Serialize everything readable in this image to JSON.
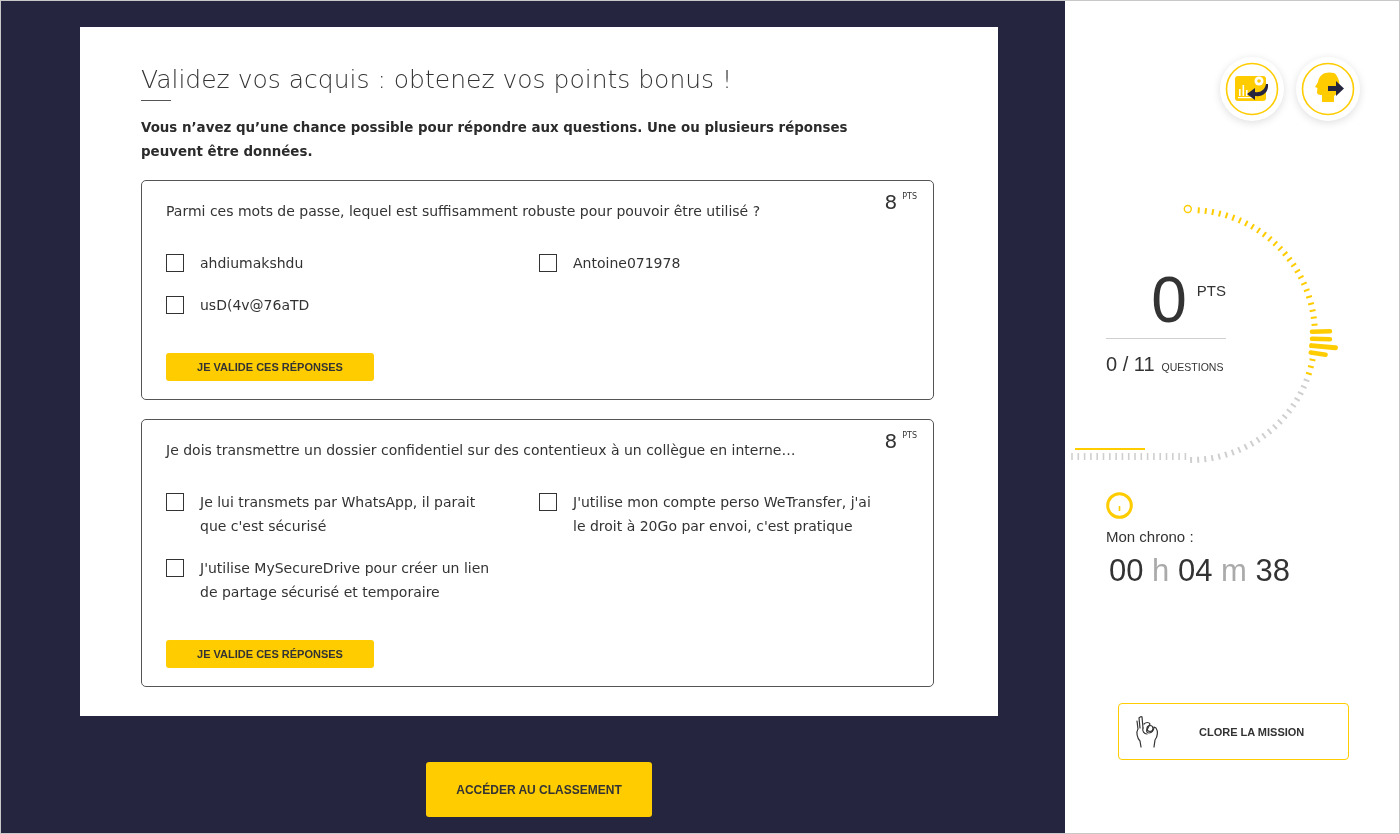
{
  "quiz": {
    "title": "Validez vos acquis : obtenez vos points bonus !",
    "instructions": "Vous n’avez qu’une chance possible pour répondre aux questions. Une ou plusieurs réponses peuvent être données.",
    "questions": [
      {
        "text": "Parmi ces mots de passe, lequel est suffisamment robuste pour pouvoir être utilisé ?",
        "points": "8",
        "points_unit": "PTS",
        "options": [
          {
            "label": "ahdiumakshdu",
            "checked": false
          },
          {
            "label": "Antoine071978",
            "checked": false
          },
          {
            "label": "usD(4v@76aTD",
            "checked": false
          }
        ],
        "submit_button": "JE VALIDE CES RÉPONSES"
      },
      {
        "text": "Je dois transmettre un dossier confidentiel sur des contentieux à un collègue en interne…",
        "points": "8",
        "points_unit": "PTS",
        "options": [
          {
            "label": "Je lui transmets par WhatsApp, il parait que c'est sécurisé",
            "checked": false
          },
          {
            "label": "J'utilise mon compte perso WeTransfer, j'ai le droit à 20Go par envoi, c'est pratique",
            "checked": false
          },
          {
            "label": "J'utilise MySecureDrive pour créer un lien de partage sécurisé et temporaire",
            "checked": false
          }
        ],
        "submit_button": "JE VALIDE CES RÉPONSES"
      }
    ]
  },
  "ranking_button": "ACCÉDER AU CLASSEMENT",
  "sidebar": {
    "score": {
      "value": "0",
      "unit": "PTS"
    },
    "questions": {
      "count": "0 / 11",
      "label": "QUESTIONS"
    },
    "timer": {
      "label": "Mon chrono :",
      "hours": "00",
      "hours_unit": "h",
      "minutes": "04",
      "minutes_unit": "m",
      "seconds": "38"
    },
    "close_button": "CLORE LA MISSION"
  }
}
